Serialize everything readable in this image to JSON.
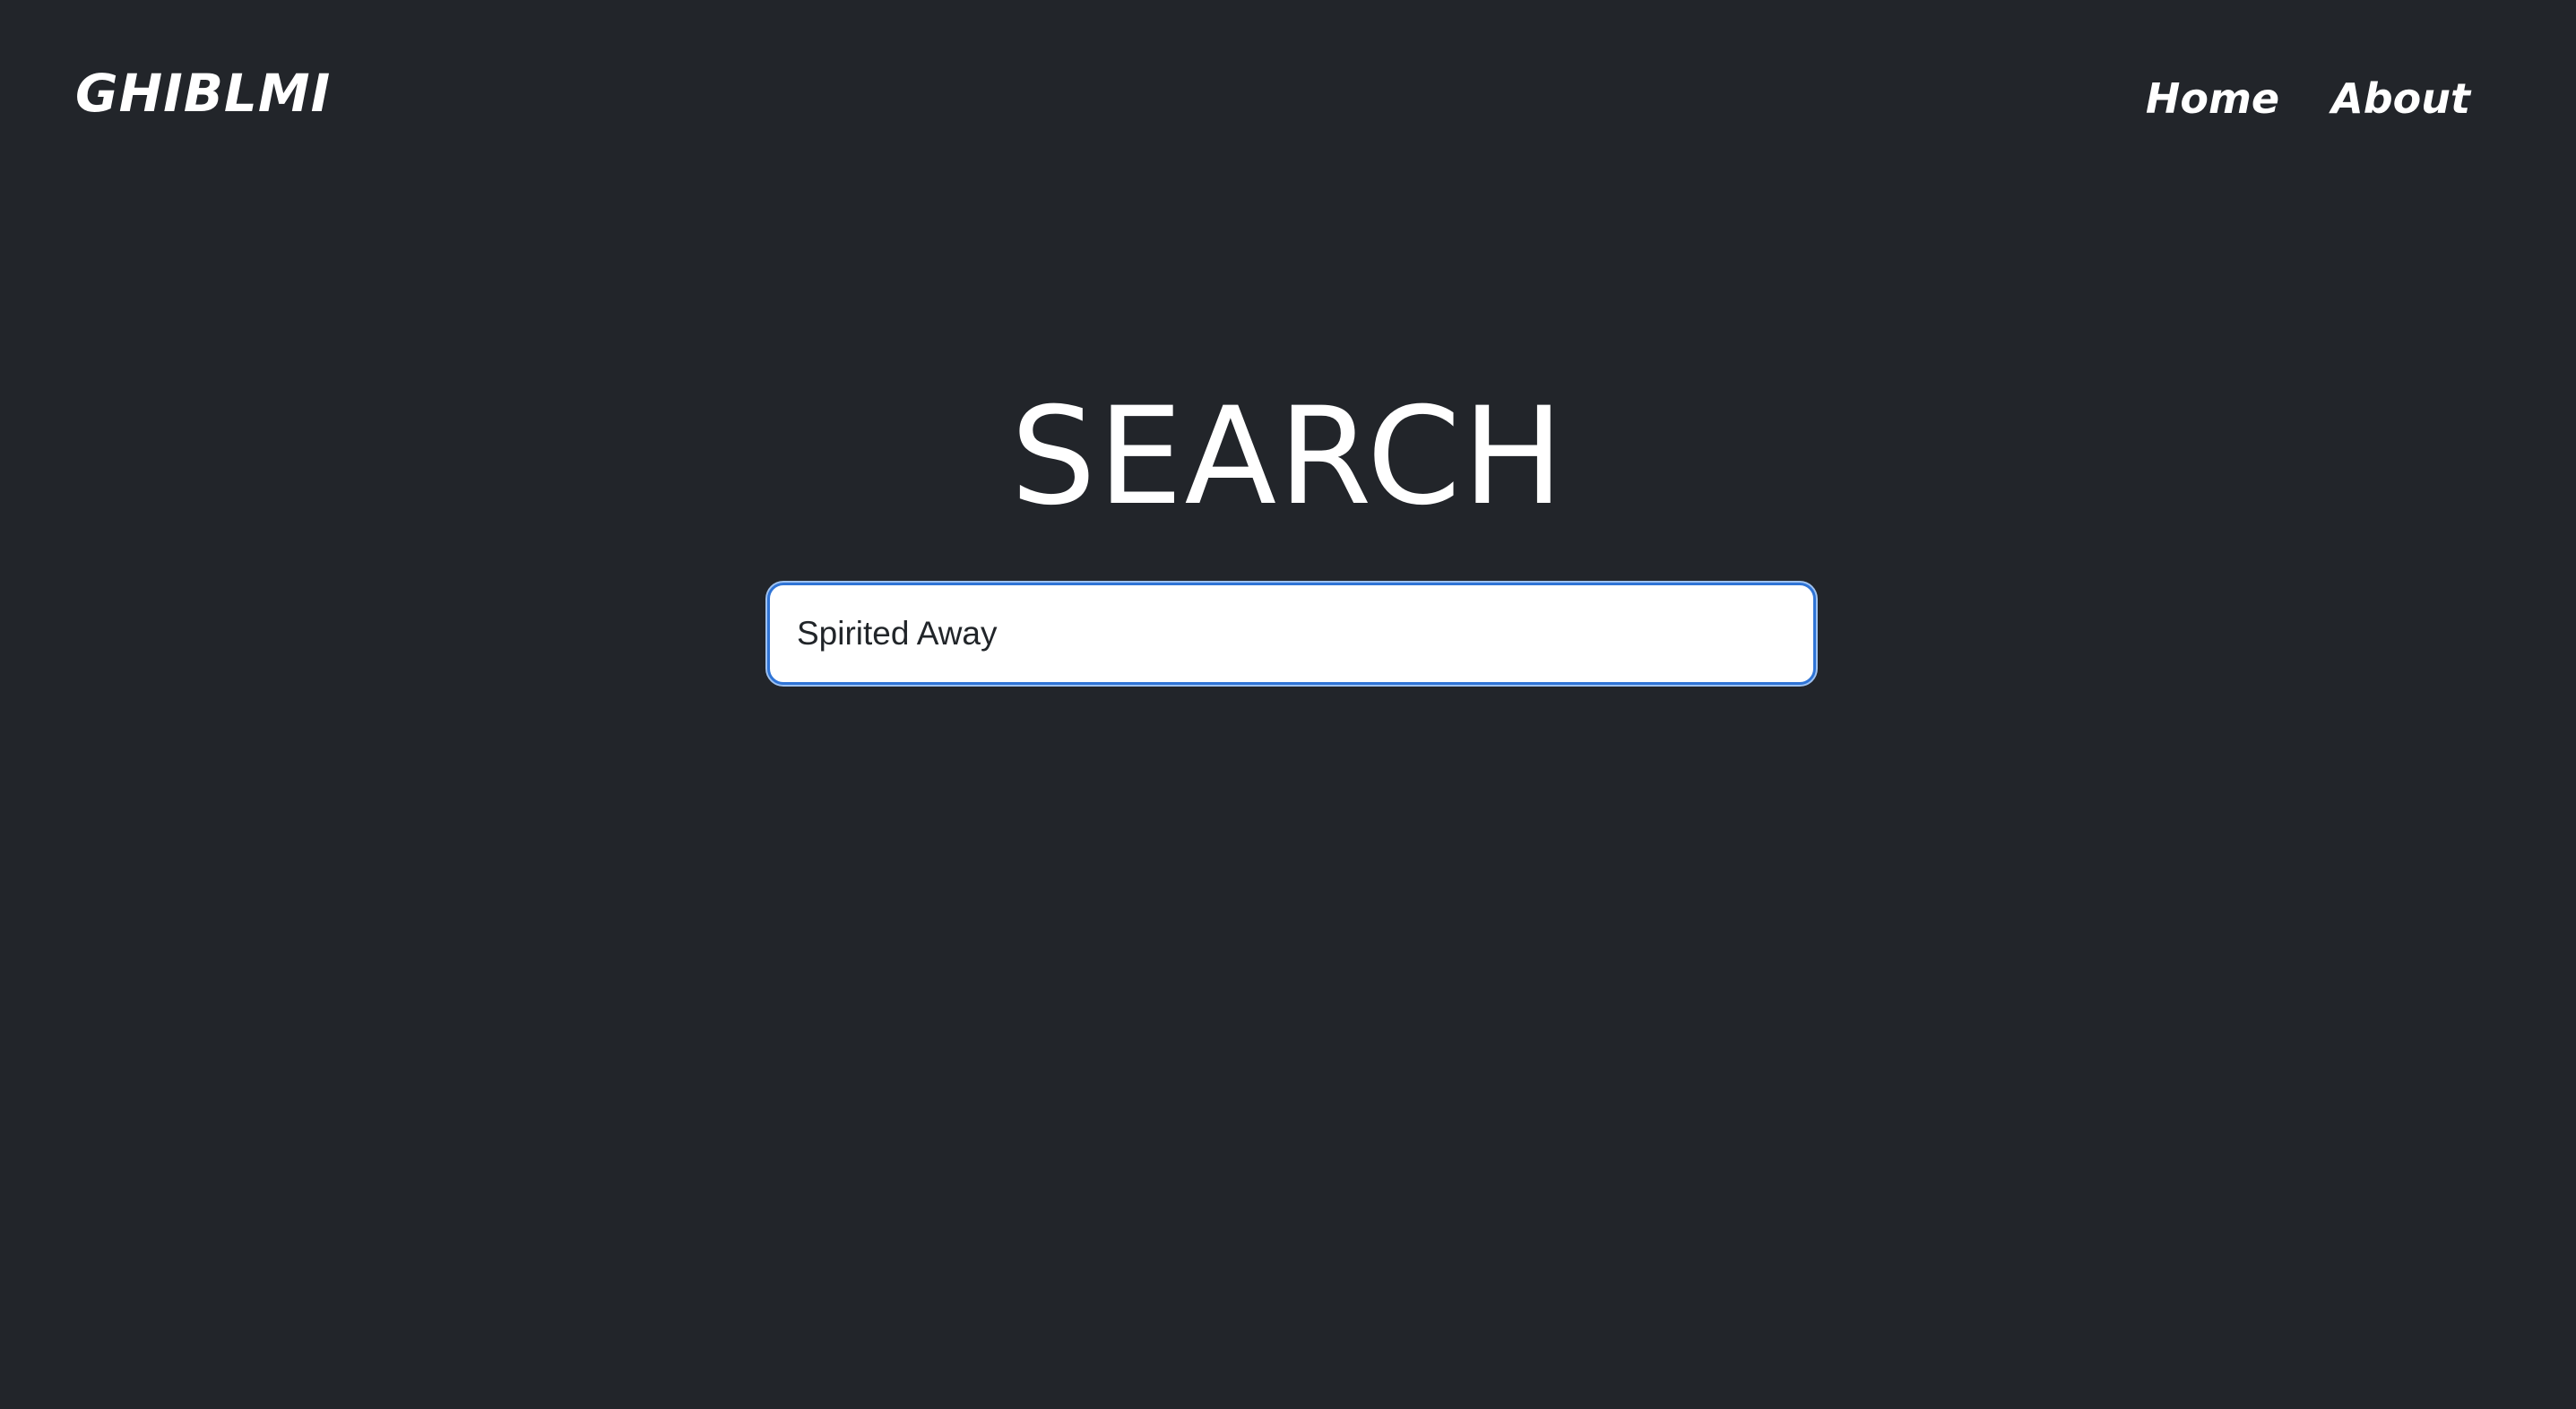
{
  "navbar": {
    "brand": "GHIBLMI",
    "links": [
      {
        "label": "Home"
      },
      {
        "label": "About"
      }
    ]
  },
  "search": {
    "title": "SEARCH",
    "input_value": "Spirited Away",
    "input_placeholder": ""
  },
  "colors": {
    "background": "#22252a",
    "text": "#ffffff",
    "input_focus_border": "#2f74d6",
    "input_text": "#212529"
  }
}
